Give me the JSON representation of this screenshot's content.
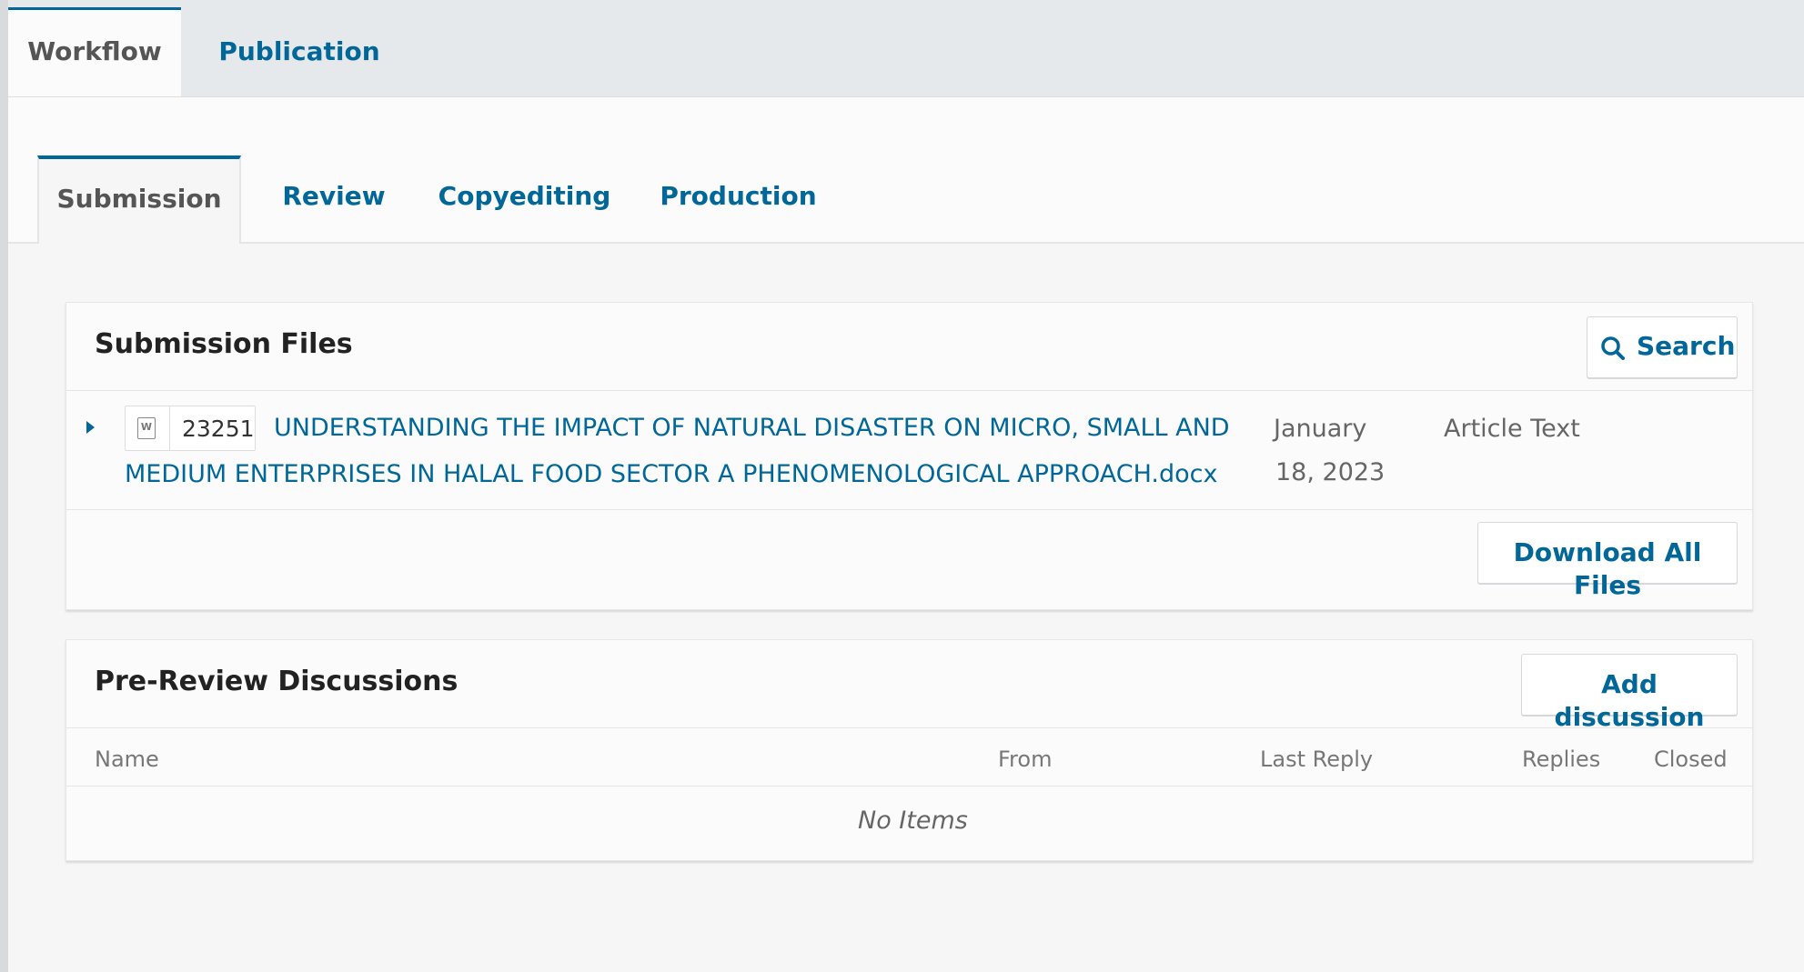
{
  "top_tabs": [
    {
      "label": "Workflow",
      "active": true
    },
    {
      "label": "Publication",
      "active": false
    }
  ],
  "sub_tabs": [
    {
      "label": "Submission",
      "active": true
    },
    {
      "label": "Review",
      "active": false
    },
    {
      "label": "Copyediting",
      "active": false
    },
    {
      "label": "Production",
      "active": false
    }
  ],
  "submission_files": {
    "title": "Submission Files",
    "search_label": "Search",
    "search_icon": "search-icon",
    "files": [
      {
        "id": "23251",
        "icon": "word-document-icon",
        "name_line1": "UNDERSTANDING THE IMPACT OF NATURAL DISASTER ON MICRO, SMALL AND",
        "name_line2": "MEDIUM ENTERPRISES IN HALAL FOOD SECTOR A PHENOMENOLOGICAL APPROACH.docx",
        "date_line1": "January",
        "date_line2": "18, 2023",
        "type": "Article Text"
      }
    ],
    "download_all_label": "Download All Files"
  },
  "discussions": {
    "title": "Pre-Review Discussions",
    "add_label": "Add discussion",
    "columns": [
      "Name",
      "From",
      "Last Reply",
      "Replies",
      "Closed"
    ],
    "empty_text": "No Items"
  },
  "colors": {
    "accent": "#006798",
    "tab_bar": "#e6e9ec",
    "background": "#f6f6f6"
  }
}
